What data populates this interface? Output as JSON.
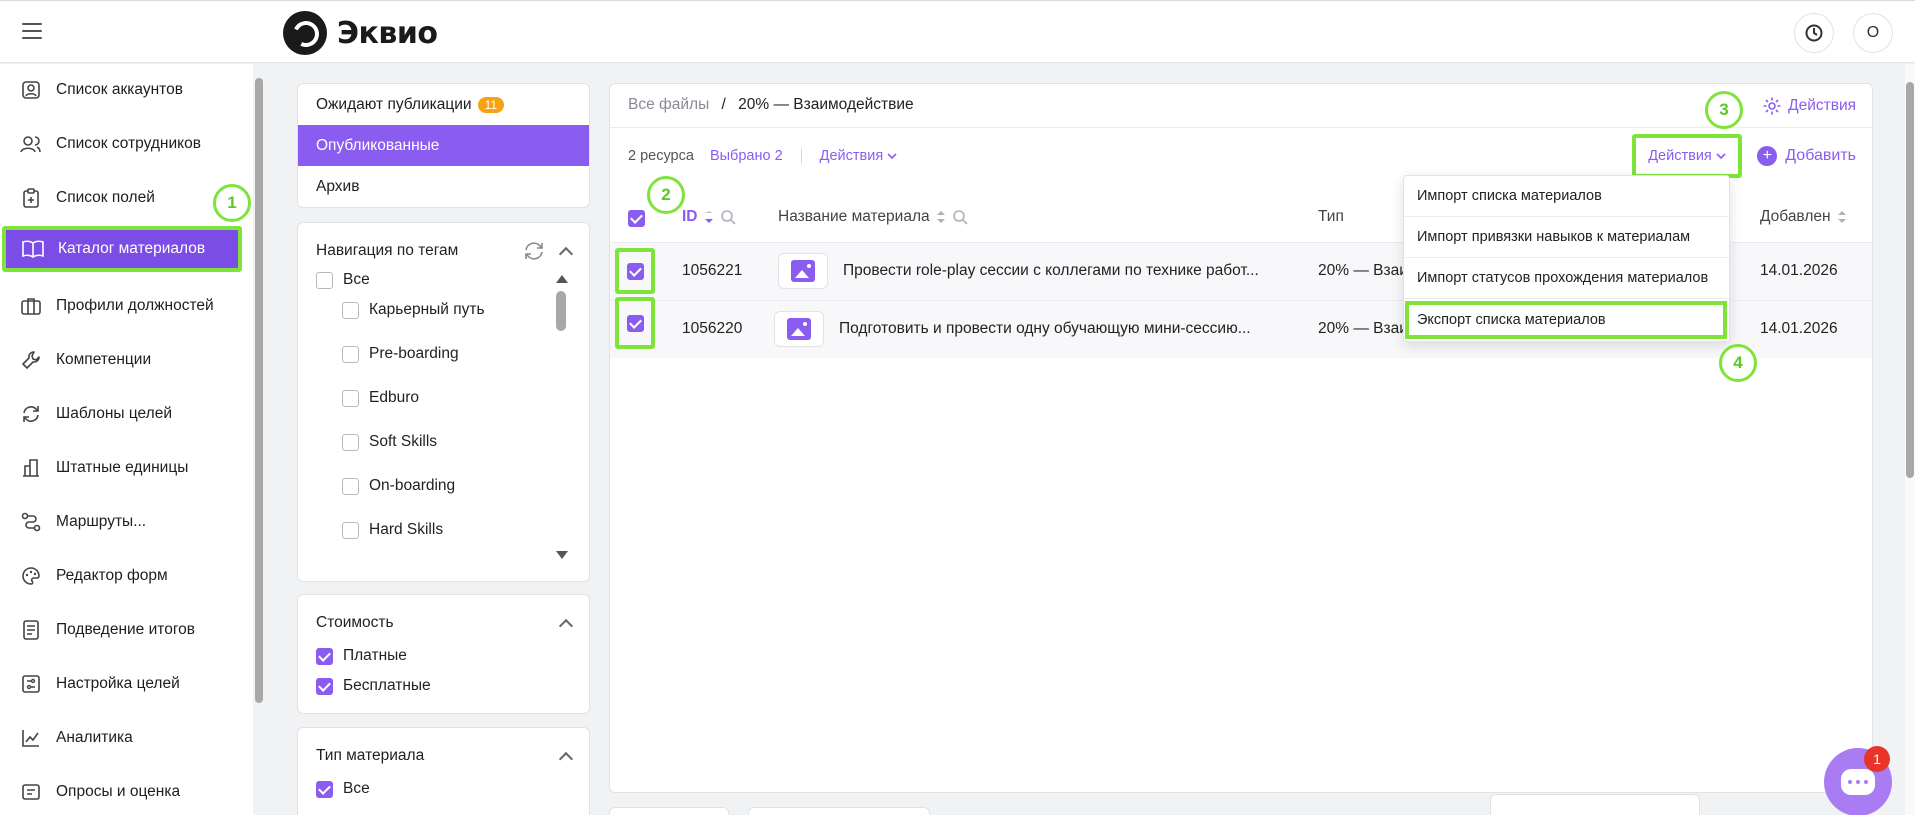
{
  "app": {
    "logo_text": "Эквио",
    "user_initial": "О"
  },
  "sidebar": {
    "items": [
      {
        "label": "Список аккаунтов",
        "icon": "user-card-icon"
      },
      {
        "label": "Список сотрудников",
        "icon": "users-icon"
      },
      {
        "label": "Список полей",
        "icon": "clipboard-icon"
      },
      {
        "label": "Каталог материалов",
        "icon": "book-icon",
        "active": true
      },
      {
        "label": "Профили должностей",
        "icon": "briefcase-icon"
      },
      {
        "label": "Компетенции",
        "icon": "wrench-icon"
      },
      {
        "label": "Шаблоны целей",
        "icon": "refresh-icon"
      },
      {
        "label": "Штатные единицы",
        "icon": "building-icon"
      },
      {
        "label": "Маршруты...",
        "icon": "route-icon"
      },
      {
        "label": "Редактор форм",
        "icon": "palette-icon"
      },
      {
        "label": "Подведение итогов",
        "icon": "document-icon"
      },
      {
        "label": "Настройка целей",
        "icon": "goal-settings-icon"
      },
      {
        "label": "Аналитика",
        "icon": "chart-line-icon"
      },
      {
        "label": "Опросы и оценка",
        "icon": "survey-icon"
      }
    ]
  },
  "statuses": {
    "pending": "Ожидают публикации",
    "pending_count": "11",
    "published": "Опубликованные",
    "archive": "Архив"
  },
  "tags": {
    "title": "Навигация по тегам",
    "all": "Все",
    "items": [
      "Карьерный путь",
      "Pre-boarding",
      "Edburo",
      "Soft Skills",
      "On-boarding",
      "Hard Skills"
    ]
  },
  "cost": {
    "title": "Стоимость",
    "paid": "Платные",
    "free": "Бесплатные"
  },
  "material_type": {
    "title": "Тип материала",
    "all": "Все"
  },
  "breadcrumb": {
    "root": "Все файлы",
    "separator": "/",
    "current": "20% — Взаимодействие"
  },
  "header_actions": "Действия",
  "toolbar": {
    "count": "2 ресурса",
    "selected": "Выбрано 2",
    "actions": "Действия",
    "actions_dropdown": "Действия",
    "add": "Добавить"
  },
  "table": {
    "columns": {
      "id": "ID",
      "name": "Название материала",
      "type": "Тип",
      "added": "Добавлен"
    },
    "rows": [
      {
        "id": "1056221",
        "name": "Провести role-play сессии с коллегами по технике работ...",
        "type": "20% — Взаи",
        "added": "14.01.2026"
      },
      {
        "id": "1056220",
        "name": "Подготовить и провести одну обучающую мини-сессию...",
        "type": "20% — Взаи",
        "added": "14.01.2026"
      }
    ]
  },
  "menu": {
    "items": [
      "Импорт списка материалов",
      "Импорт привязки навыков к материалам",
      "Импорт статусов прохождения материалов",
      "Экспорт списка материалов"
    ]
  },
  "steps": [
    "1",
    "2",
    "3",
    "4"
  ],
  "chat": {
    "notifications": "1"
  },
  "colors": {
    "accent": "#8b5cf0",
    "highlight": "#7ee43a",
    "badge": "#f6a313",
    "notif": "#e9342a"
  }
}
